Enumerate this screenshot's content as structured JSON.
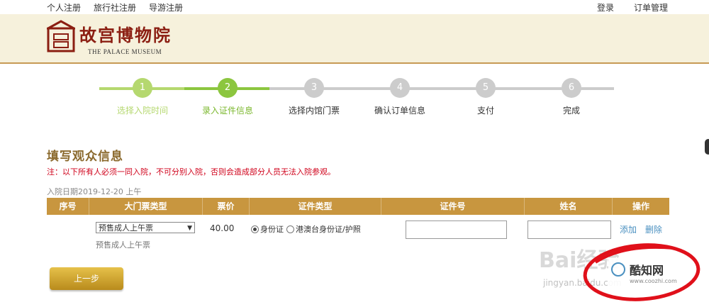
{
  "topnav": {
    "left": [
      "个人注册",
      "旅行社注册",
      "导游注册"
    ],
    "right": [
      "登录",
      "订单管理"
    ]
  },
  "logo": {
    "cn": "故宫博物院",
    "en": "THE PALACE MUSEUM"
  },
  "steps": [
    {
      "num": "1",
      "label": "选择入院时间",
      "state": "done"
    },
    {
      "num": "2",
      "label": "录入证件信息",
      "state": "active"
    },
    {
      "num": "3",
      "label": "选择内馆门票",
      "state": "todo"
    },
    {
      "num": "4",
      "label": "确认订单信息",
      "state": "todo"
    },
    {
      "num": "5",
      "label": "支付",
      "state": "todo"
    },
    {
      "num": "6",
      "label": "完成",
      "state": "todo"
    }
  ],
  "colors": {
    "done": "#b5d86f",
    "active": "#8cc63f",
    "todo": "#cccccc",
    "header_gold": "#c8963f"
  },
  "form": {
    "title": "填写观众信息",
    "notice": "注：以下所有人必须一同入院，不可分别入院，否则会造成部分人员无法入院参观。",
    "visit_date": "入院日期2019-12-20 上午"
  },
  "table": {
    "headers": [
      "序号",
      "大门票类型",
      "票价",
      "证件类型",
      "证件号",
      "姓名",
      "操作"
    ],
    "row": {
      "ticket_type": "预售成人上午票",
      "ticket_sub": "预售成人上午票",
      "price": "40.00",
      "id_type_options": [
        "身份证",
        "港澳台身份证/护照"
      ],
      "id_number": "",
      "name": "",
      "actions": [
        "添加",
        "删除"
      ]
    }
  },
  "prev_button": "上一步",
  "watermark": {
    "baidu": "Bai经验",
    "jy": "jingyan.baidu.com",
    "badge": "酷知网",
    "badge_url": "www.coozhi.com"
  }
}
